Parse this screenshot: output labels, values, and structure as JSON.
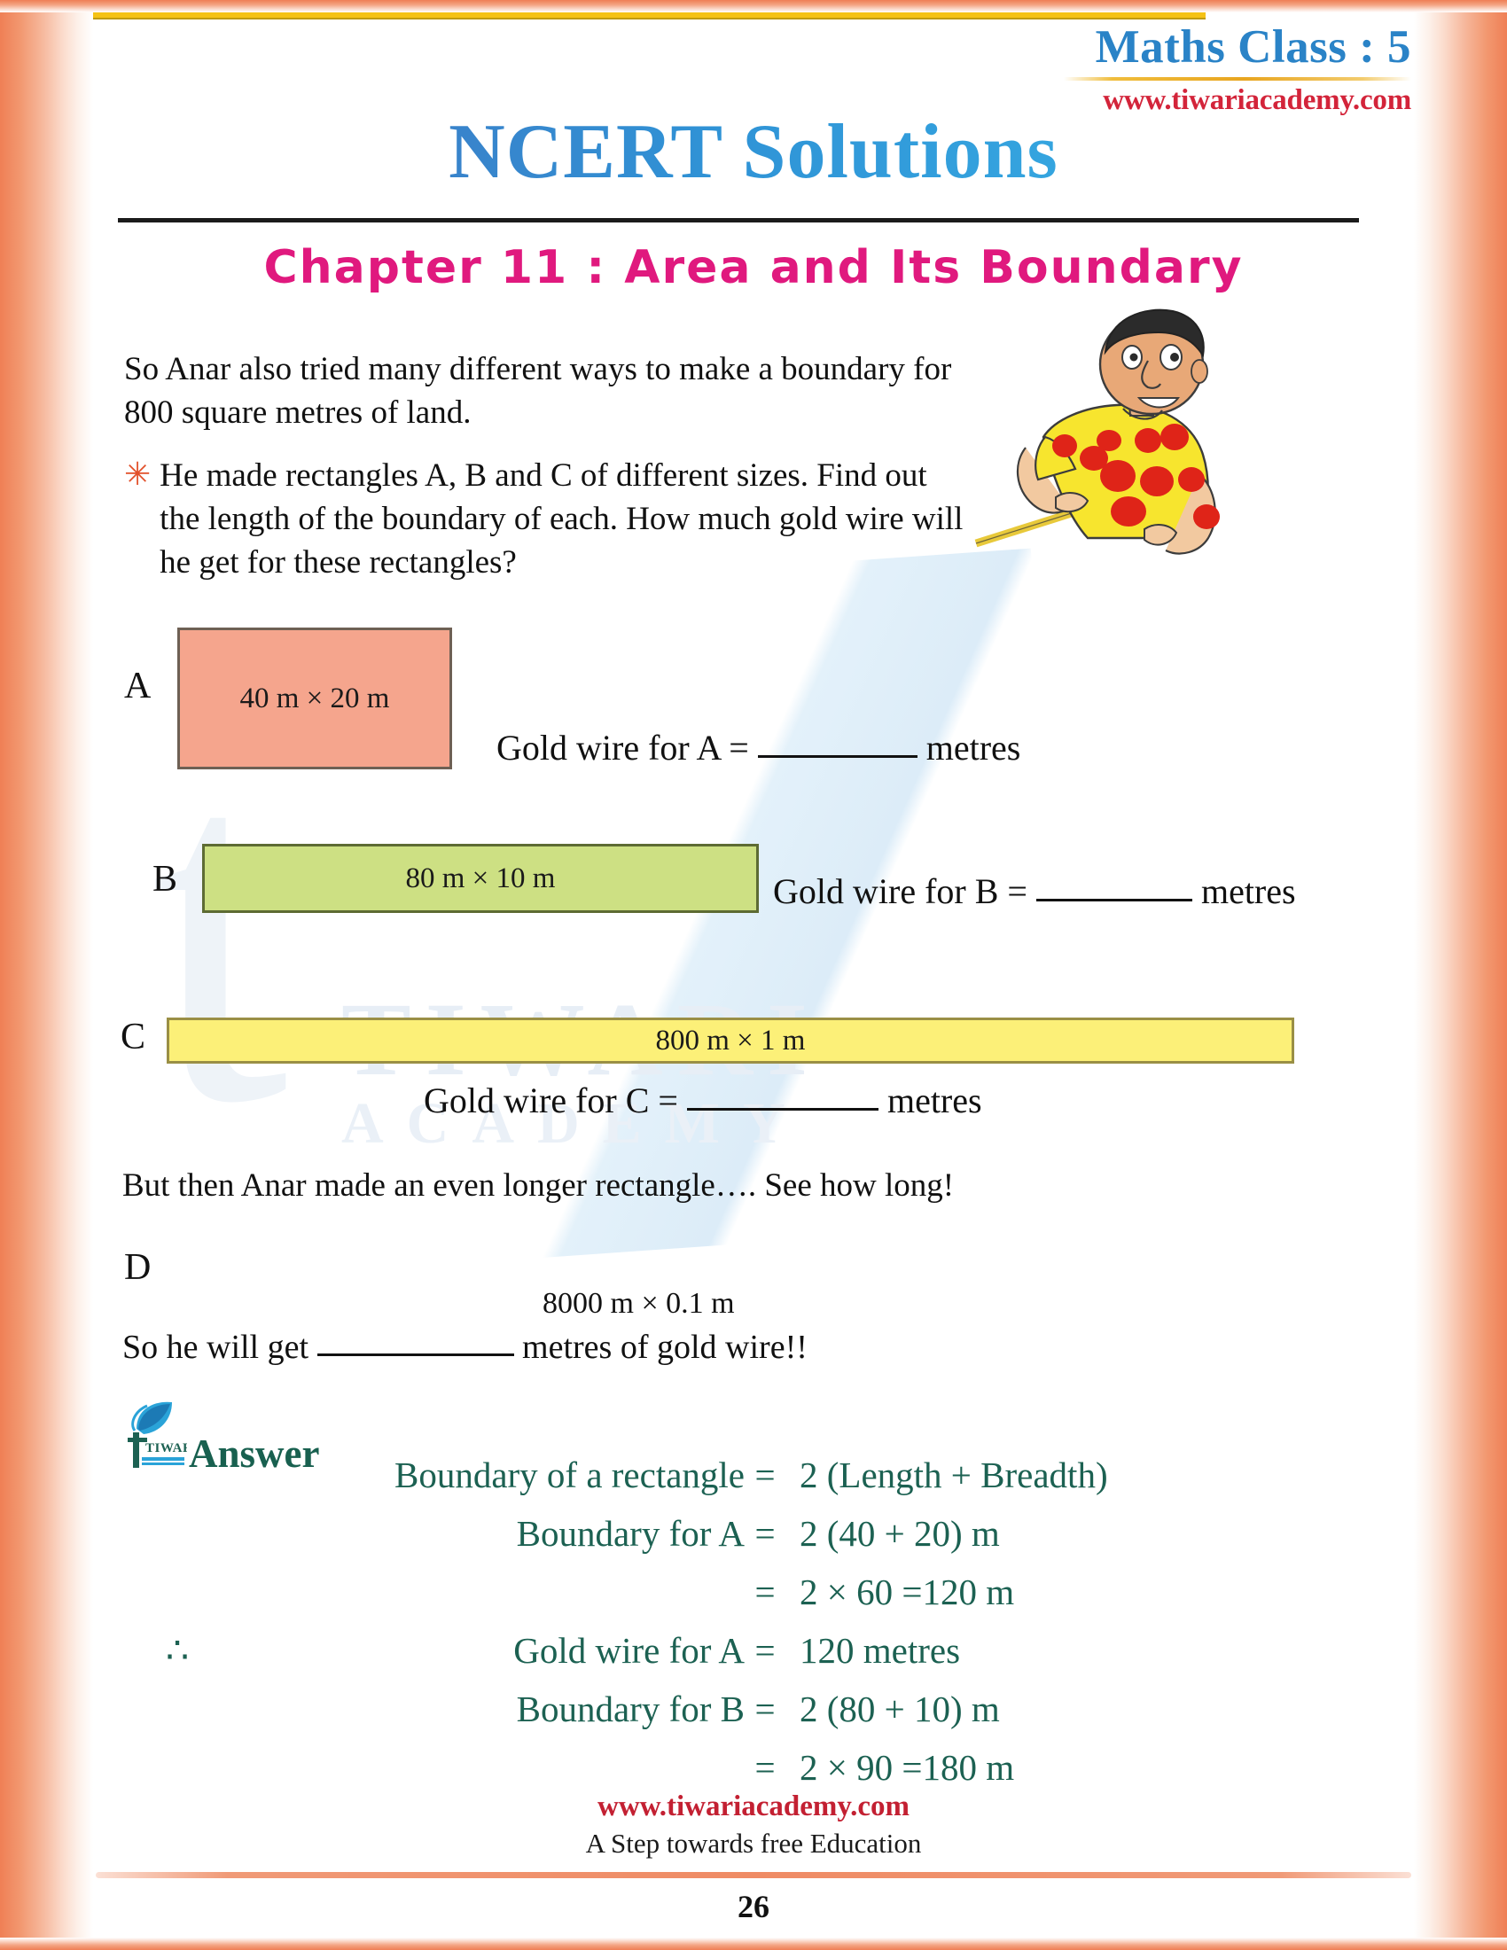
{
  "header": {
    "class_label": "Maths Class : 5",
    "url": "www.tiwariacademy.com",
    "site_title": "NCERT Solutions",
    "chapter_title": "Chapter 11 : Area and Its Boundary"
  },
  "content": {
    "intro": "So Anar also tried many different ways to make a boundary for 800 square metres of land.",
    "bullet_marker": "✳",
    "bullet_text": "He made rectangles A, B and C of different sizes. Find out the length of the boundary of each. How much gold wire will he get for these rectangles?",
    "transition": "But then Anar made an even longer rectangle…. See how long!",
    "d_caption": "8000 m × 0.1 m",
    "conclusion_before": "So he will get",
    "conclusion_after": "metres of gold wire!!"
  },
  "rectangles": [
    {
      "label": "A",
      "dimensions": "40 m × 20 m",
      "fill": "#f5a58d",
      "stroke": "#6e6054"
    },
    {
      "label": "B",
      "dimensions": "80 m × 10 m",
      "fill": "#cde083",
      "stroke": "#5d6b33"
    },
    {
      "label": "C",
      "dimensions": "800 m × 1 m",
      "fill": "#fcf078",
      "stroke": "#9a8f45"
    },
    {
      "label": "D",
      "dimensions": "8000 m × 0.1 m",
      "fill": "#f5c215",
      "stroke": "#c09a12"
    }
  ],
  "gold_wire_prompts": [
    {
      "text_before": "Gold wire for A =",
      "text_after": "metres"
    },
    {
      "text_before": "Gold wire for B =",
      "text_after": "metres"
    },
    {
      "text_before": "Gold wire for C =",
      "text_after": "metres"
    }
  ],
  "answer": {
    "heading": "Answer",
    "logo_text": "TIWARI",
    "lines": [
      {
        "symbol": "",
        "left": "Boundary of a rectangle",
        "eq": "=",
        "right": "2 (Length + Breadth)"
      },
      {
        "symbol": "",
        "left": "Boundary for A",
        "eq": "=",
        "right": "2 (40 + 20) m"
      },
      {
        "symbol": "",
        "left": "",
        "eq": "=",
        "right": "2 × 60 =120 m"
      },
      {
        "symbol": "∴",
        "left": "Gold wire for A",
        "eq": "=",
        "right": "120 metres"
      },
      {
        "symbol": "",
        "left": "Boundary for B",
        "eq": "=",
        "right": "2 (80 + 10) m"
      },
      {
        "symbol": "",
        "left": "",
        "eq": "=",
        "right": "2 × 90 =180 m"
      }
    ]
  },
  "watermark": {
    "mark_letter": "t",
    "word1": "TIWARI",
    "word2": "ACADEMY"
  },
  "footer": {
    "url": "www.tiwariacademy.com",
    "tagline": "A Step towards free Education",
    "page_number": "26"
  },
  "colors": {
    "brand_blue": "#2a83c7",
    "brand_red": "#d3243a",
    "chapter_magenta": "#e0197e",
    "answer_green": "#1c6152",
    "border_orange": "#ef7f55"
  }
}
